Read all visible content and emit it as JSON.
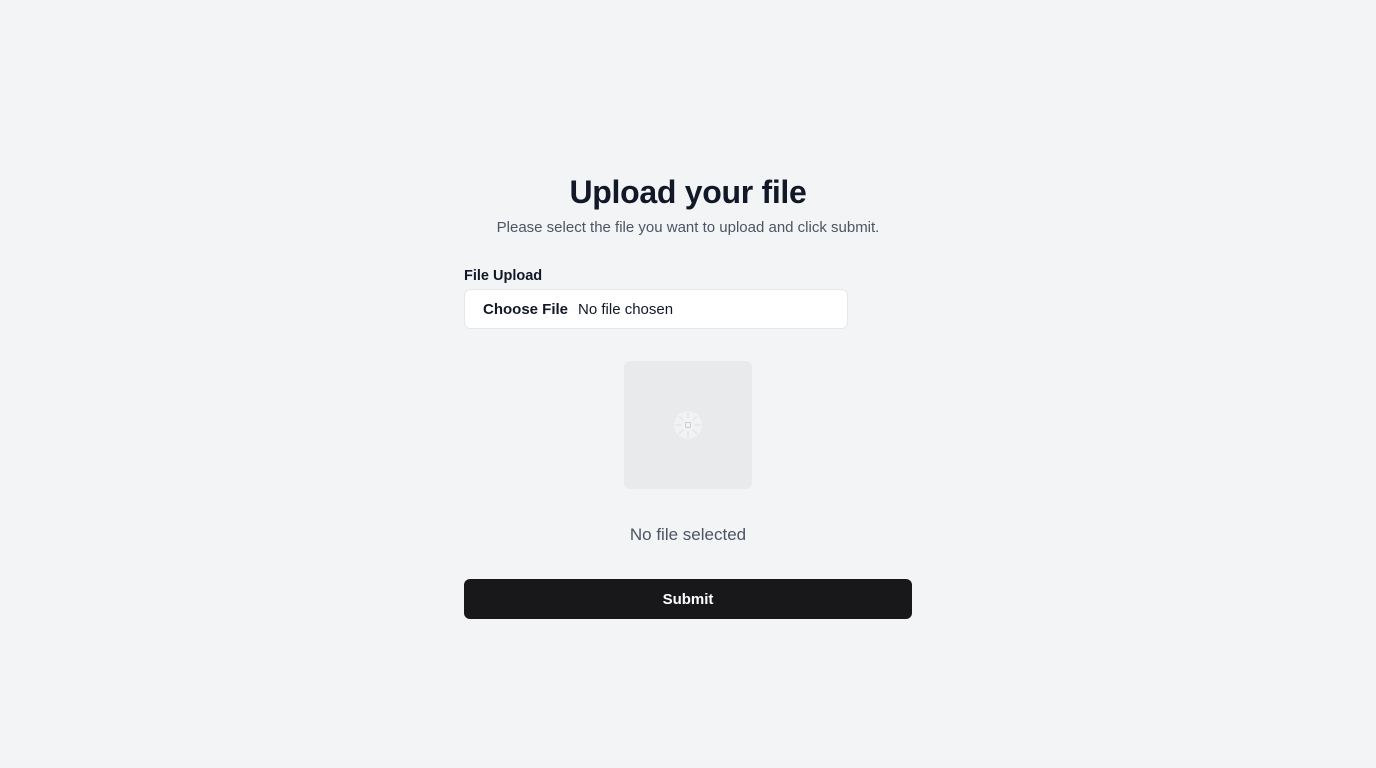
{
  "page": {
    "title": "Upload your file",
    "subtitle": "Please select the file you want to upload and click submit."
  },
  "form": {
    "file_label": "File Upload",
    "choose_button_label": "Choose File",
    "file_input_status": "No file chosen",
    "preview_icon": "image-placeholder-icon",
    "no_file_text": "No file selected",
    "submit_label": "Submit"
  },
  "colors": {
    "background": "#f3f4f6",
    "heading": "#111827",
    "muted_text": "#4b5563",
    "input_background": "#ffffff",
    "input_border": "#e5e7eb",
    "preview_background": "#e9eaeb",
    "submit_background": "#18181b",
    "submit_text": "#ffffff"
  }
}
